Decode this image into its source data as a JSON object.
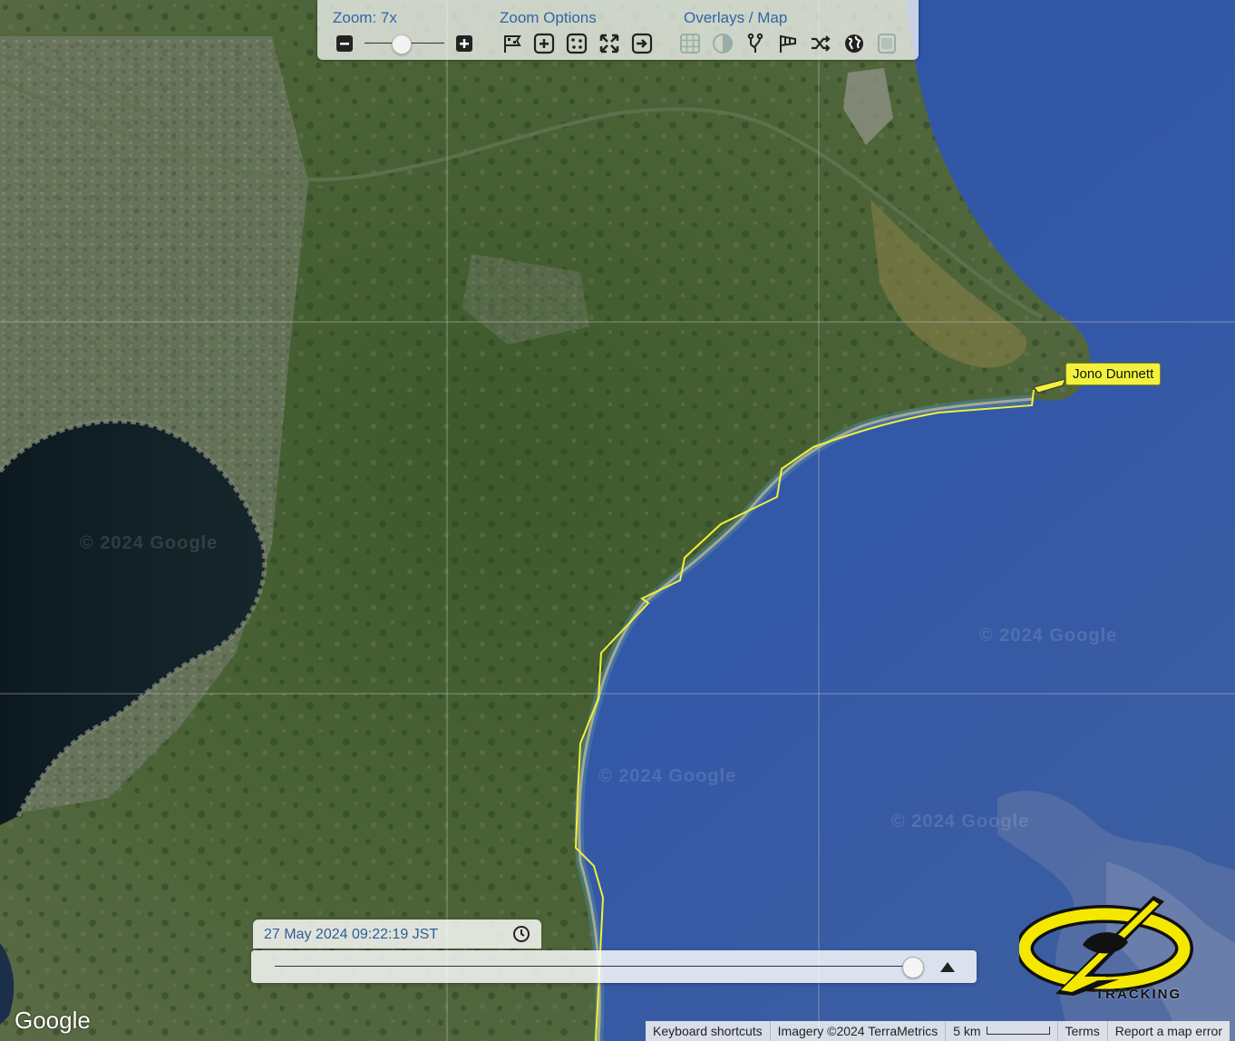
{
  "controls": {
    "zoom_label": "Zoom: 7x",
    "zoom_options_label": "Zoom Options",
    "overlays_label": "Overlays / Map",
    "zoom_level": 0.45,
    "icons": {
      "zoom_out": "minus-icon",
      "zoom_in": "plus-icon",
      "leaderboard": "flags-icon",
      "zoom_to_boat": "plus-square-icon",
      "zoom_to_all": "dots-icon",
      "full_extent": "expand-arrows-icon",
      "follow": "arrow-right-icon",
      "grid": "grid-icon",
      "day_night": "contrast-icon",
      "tracks": "fork-icon",
      "wind": "windsock-icon",
      "shuffle": "shuffle-icon",
      "globe": "globe-icon",
      "layer": "layer-icon"
    }
  },
  "boat": {
    "name": "Jono Dunnett",
    "color": "#f2f23c"
  },
  "time": {
    "label": "27 May 2024 09:22:19 JST",
    "slider_position": 0.99
  },
  "logo": {
    "text": "TRACKING",
    "color": "#f5e800"
  },
  "map": {
    "google_logo": "Google",
    "watermark": "© 2024 Google",
    "water_color": "#2c4f9c",
    "track_color": "#f0f03a"
  },
  "attribution": {
    "keyboard": "Keyboard shortcuts",
    "imagery": "Imagery ©2024 TerraMetrics",
    "scale": "5 km",
    "terms": "Terms",
    "report": "Report a map error"
  }
}
